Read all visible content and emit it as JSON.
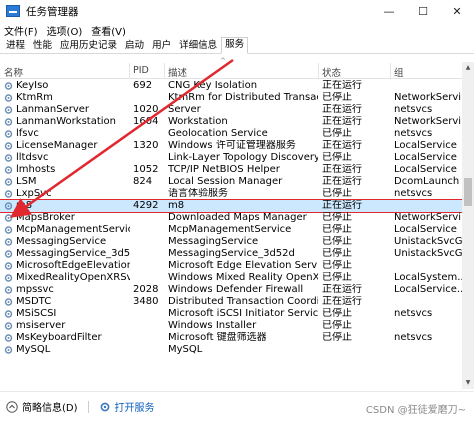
{
  "window": {
    "title": "任务管理器",
    "minimize": "—",
    "maximize": "☐",
    "close": "✕"
  },
  "menu": [
    "文件(F)",
    "选项(O)",
    "查看(V)"
  ],
  "tabs": [
    "进程",
    "性能",
    "应用历史记录",
    "启动",
    "用户",
    "详细信息",
    "服务"
  ],
  "active_tab": "服务",
  "columns": {
    "name": "名称",
    "pid": "PID",
    "desc": "描述",
    "status": "状态",
    "group": "组"
  },
  "rows": [
    {
      "name": "KeyIso",
      "pid": "692",
      "desc": "CNG Key Isolation",
      "status": "正在运行",
      "group": ""
    },
    {
      "name": "KtmRm",
      "pid": "",
      "desc": "KtmRm for Distributed Transaction...",
      "status": "已停止",
      "group": "NetworkServi..."
    },
    {
      "name": "LanmanServer",
      "pid": "1020",
      "desc": "Server",
      "status": "正在运行",
      "group": "netsvcs"
    },
    {
      "name": "LanmanWorkstation",
      "pid": "1604",
      "desc": "Workstation",
      "status": "正在运行",
      "group": "NetworkServi..."
    },
    {
      "name": "lfsvc",
      "pid": "",
      "desc": "Geolocation Service",
      "status": "已停止",
      "group": "netsvcs"
    },
    {
      "name": "LicenseManager",
      "pid": "1320",
      "desc": "Windows 许可证管理器服务",
      "status": "正在运行",
      "group": "LocalService"
    },
    {
      "name": "lltdsvc",
      "pid": "",
      "desc": "Link-Layer Topology Discovery M...",
      "status": "已停止",
      "group": "LocalService"
    },
    {
      "name": "lmhosts",
      "pid": "1052",
      "desc": "TCP/IP NetBIOS Helper",
      "status": "正在运行",
      "group": "LocalService"
    },
    {
      "name": "LSM",
      "pid": "824",
      "desc": "Local Session Manager",
      "status": "正在运行",
      "group": "DcomLaunch"
    },
    {
      "name": "LxpSvc",
      "pid": "",
      "desc": "语言体验服务",
      "status": "已停止",
      "group": "netsvcs"
    },
    {
      "name": "m8",
      "pid": "4292",
      "desc": "m8",
      "status": "正在运行",
      "group": ""
    },
    {
      "name": "MapsBroker",
      "pid": "",
      "desc": "Downloaded Maps Manager",
      "status": "已停止",
      "group": "NetworkServi..."
    },
    {
      "name": "McpManagementService",
      "pid": "",
      "desc": "McpManagementService",
      "status": "已停止",
      "group": "LocalService"
    },
    {
      "name": "MessagingService",
      "pid": "",
      "desc": "MessagingService",
      "status": "已停止",
      "group": "UnistackSvcG..."
    },
    {
      "name": "MessagingService_3d52d",
      "pid": "",
      "desc": "MessagingService_3d52d",
      "status": "已停止",
      "group": "UnistackSvcG..."
    },
    {
      "name": "MicrosoftEdgeElevations...",
      "pid": "",
      "desc": "Microsoft Edge Elevation Service (...",
      "status": "已停止",
      "group": ""
    },
    {
      "name": "MixedRealityOpenXRSvc",
      "pid": "",
      "desc": "Windows Mixed Reality OpenXR S...",
      "status": "已停止",
      "group": "LocalSystem..."
    },
    {
      "name": "mpssvc",
      "pid": "2028",
      "desc": "Windows Defender Firewall",
      "status": "正在运行",
      "group": "LocalService..."
    },
    {
      "name": "MSDTC",
      "pid": "3480",
      "desc": "Distributed Transaction Coordinat...",
      "status": "正在运行",
      "group": ""
    },
    {
      "name": "MSiSCSI",
      "pid": "",
      "desc": "Microsoft iSCSI Initiator Service",
      "status": "已停止",
      "group": "netsvcs"
    },
    {
      "name": "msiserver",
      "pid": "",
      "desc": "Windows Installer",
      "status": "已停止",
      "group": ""
    },
    {
      "name": "MsKeyboardFilter",
      "pid": "",
      "desc": "Microsoft 键盘筛选器",
      "status": "已停止",
      "group": "netsvcs"
    },
    {
      "name": "MySQL",
      "pid": "",
      "desc": "MySQL",
      "status": "",
      "group": ""
    }
  ],
  "selected_row": 10,
  "footer": {
    "less_details": "简略信息(D)",
    "open_services": "打开服务"
  },
  "watermark": "CSDN @狂徒爱磨刀~",
  "colors": {
    "selection": "#cce8ff",
    "highlight_border": "#e0282e",
    "arrow": "#e0282e",
    "link": "#0b5fbf"
  }
}
